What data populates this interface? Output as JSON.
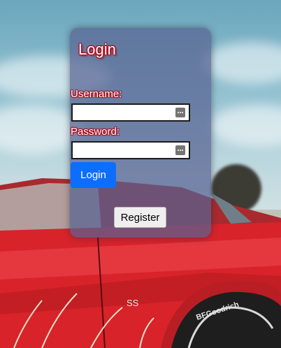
{
  "login_form": {
    "title": "Login",
    "username_label": "Username:",
    "username_value": "",
    "password_label": "Password:",
    "password_value": "",
    "login_button": "Login",
    "register_button": "Register"
  },
  "icons": {
    "username_field_icon": "password-manager-key-icon",
    "password_field_icon": "password-manager-key-icon"
  },
  "background": {
    "car_badge": "SS",
    "tire_text": "BFGoodrich"
  },
  "colors": {
    "panel": "#586291",
    "title_shadow": "#b00010",
    "login_button": "#0d6efd",
    "car_body": "#d8232a"
  }
}
